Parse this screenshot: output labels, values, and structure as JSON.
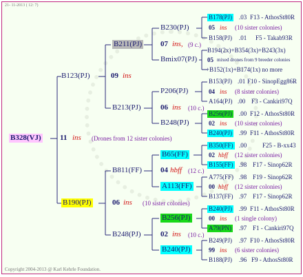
{
  "header": {
    "date": "21- 11-2013 ( 12: 7)"
  },
  "footer": {
    "copyright": "Copyright 2004-2013 @ Karl Kehrle Foundation."
  },
  "root": {
    "name": "B328(VJ)"
  },
  "gen1": {
    "year": "11",
    "ins": "ins",
    "drones": "(Drones from 12 sister colonies)",
    "father": "B123(PJ)",
    "mother": "B190(PJ)"
  },
  "f_branch": {
    "year": "09",
    "ins": "ins",
    "f": "B211(PJ)",
    "m": "B213(PJ)",
    "f_year": "07",
    "f_ins": "ins,",
    "f_count": "(9 c.)",
    "f_f": "B230(PJ)",
    "f_m": "Bmix07(PJ)",
    "m_year": "06",
    "m_ins": "ins",
    "m_count": "(10 c.)",
    "m_f": "P206(PJ)",
    "m_m": "B248(PJ)"
  },
  "m_branch": {
    "year": "06",
    "ins": "ins",
    "count": "(10 sister colonies)",
    "f": "B811(FF)",
    "m": "B248(PJ)",
    "f_year": "04",
    "f_ins": "hbff",
    "f_count": "(12 c.)",
    "f_f": "B65(FF)",
    "f_m": "A113(FF)",
    "m_year": "02",
    "m_ins": "ins",
    "m_count": "(10 c.)",
    "m_f": "B256(PJ)",
    "m_m": "B240(PJ)"
  },
  "leaves": [
    {
      "id": "B178(PJ)",
      "yr": ".03",
      "station": "F13 - AthosSt80R"
    },
    {
      "year": "05",
      "ins": "ins",
      "note": "(10 sister colonies)"
    },
    {
      "id": "B158(PJ)",
      "yr": ".01",
      "station": "F5 - Takab93R"
    },
    {
      "text": "B194(2x)+B354(3x)+B243(3x)"
    },
    {
      "year": "05",
      "note": "mixed drones from 9 breeder colonies"
    },
    {
      "text": "+B152(1x)+B174(1x) no more"
    },
    {
      "id": "B153(PJ)",
      "yr": ".01",
      "station": "F10 - SinopEgg86R"
    },
    {
      "year": "04",
      "ins": "ins",
      "note": "(8 sister colonies)"
    },
    {
      "id": "A164(PJ)",
      "yr": ".00",
      "station": "F3 - Cankiri97Q"
    },
    {
      "id": "B256(PJ)",
      "yr": ".00",
      "station": "F12 - AthosSt80R"
    },
    {
      "year": "02",
      "ins": "ins",
      "note": "(10 sister colonies)"
    },
    {
      "id": "B240(PJ)",
      "yr": ".99",
      "station": "F11 - AthosSt80R"
    },
    {
      "id": "B350(FF)",
      "yr": ".00",
      "station": "F25 - B-xx43"
    },
    {
      "year": "02",
      "ins": "hbff",
      "note": "(12 sister colonies)"
    },
    {
      "id": "B155(FF)",
      "yr": ".98",
      "station": "F17 - Sinop62R"
    },
    {
      "id": "A775(FF)",
      "yr": ".98",
      "station": "F19 - Sinop62R"
    },
    {
      "year": "00",
      "ins": "hbff",
      "note": "(12 sister colonies)"
    },
    {
      "id": "B137(FF)",
      "yr": ".97",
      "station": "F17 - Sinop62R"
    },
    {
      "id": "B240(PJ)",
      "yr": ".99",
      "station": "F11 - AthosSt80R"
    },
    {
      "year": "00",
      "ins": "ins",
      "note": "(1 single colony)"
    },
    {
      "id": "A79(PN)",
      "yr": ".97",
      "station": "F1 - Cankiri97Q"
    },
    {
      "id": "B249(PJ)",
      "yr": ".97",
      "station": "F10 - AthosSt80R"
    },
    {
      "year": "99",
      "ins": "ins",
      "note": "(6 sister colonies)"
    },
    {
      "id": "B188(PJ)",
      "yr": ".96",
      "station": "F9 - AthosSt80R"
    }
  ]
}
